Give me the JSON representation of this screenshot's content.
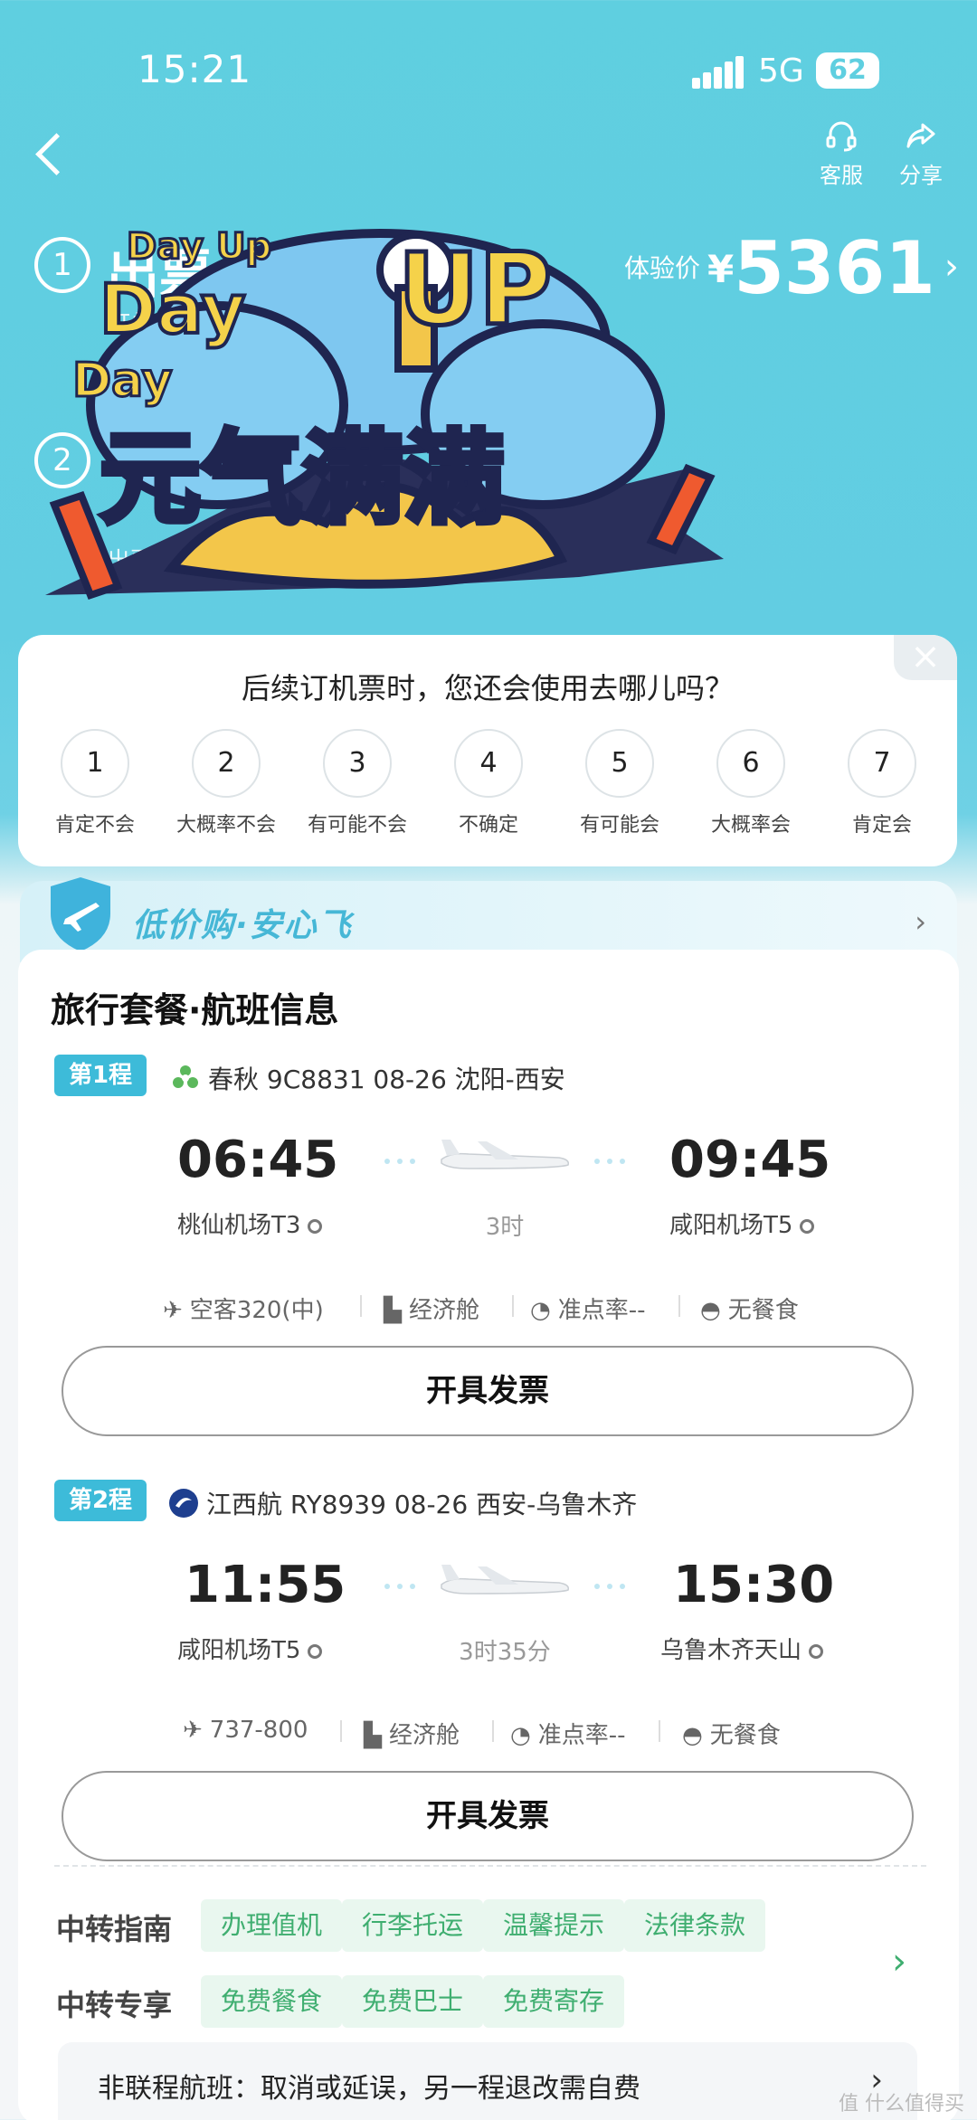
{
  "status_bar": {
    "time": "15:21",
    "network": "5G",
    "battery": "62"
  },
  "nav": {
    "service_label": "客服",
    "share_label": "分享"
  },
  "progress": {
    "step1_num": "1",
    "step1_title": "出票",
    "step1_sub1": "订单",
    "step1_sub2": "出",
    "step2_num": "2",
    "step2_sub": "出票",
    "price_label": "体验价",
    "price_currency": "¥",
    "price_value": "5361"
  },
  "sticker": {
    "line1": "Day Up",
    "line2": "Day",
    "line3": "UP",
    "line4": "Day",
    "slogan": "元气满满"
  },
  "survey": {
    "question": "后续订机票时，您还会使用去哪儿吗？",
    "options": [
      {
        "num": "1",
        "label": "肯定不会"
      },
      {
        "num": "2",
        "label": "大概率不会"
      },
      {
        "num": "3",
        "label": "有可能不会"
      },
      {
        "num": "4",
        "label": "不确定"
      },
      {
        "num": "5",
        "label": "有可能会"
      },
      {
        "num": "6",
        "label": "大概率会"
      },
      {
        "num": "7",
        "label": "肯定会"
      }
    ]
  },
  "safe_banner": {
    "text": "低价购·安心飞"
  },
  "main": {
    "title": "旅行套餐·航班信息",
    "legs": [
      {
        "tag": "第1程",
        "airline": "春秋 9C8831   08-26 沈阳-西安",
        "dep_time": "06:45",
        "dep_airport": "桃仙机场T3",
        "duration": "3时",
        "arr_time": "09:45",
        "arr_airport": "咸阳机场T5",
        "aircraft": "空客320(中)",
        "cabin": "经济舱",
        "ontime": "准点率--",
        "meal": "无餐食",
        "button": "开具发票"
      },
      {
        "tag": "第2程",
        "airline": "江西航 RY8939   08-26 西安-乌鲁木齐",
        "dep_time": "11:55",
        "dep_airport": "咸阳机场T5",
        "duration": "3时35分",
        "arr_time": "15:30",
        "arr_airport": "乌鲁木齐天山",
        "aircraft": "737-800",
        "cabin": "经济舱",
        "ontime": "准点率--",
        "meal": "无餐食",
        "button": "开具发票"
      }
    ],
    "guide": {
      "label": "中转指南",
      "chips": [
        "办理值机",
        "行李托运",
        "温馨提示",
        "法律条款"
      ]
    },
    "perks": {
      "label": "中转专享",
      "chips": [
        "免费餐食",
        "免费巴士",
        "免费寄存"
      ]
    },
    "notice": "非联程航班：取消或延误，另一程退改需自费"
  },
  "watermark": "值 什么值得买"
}
